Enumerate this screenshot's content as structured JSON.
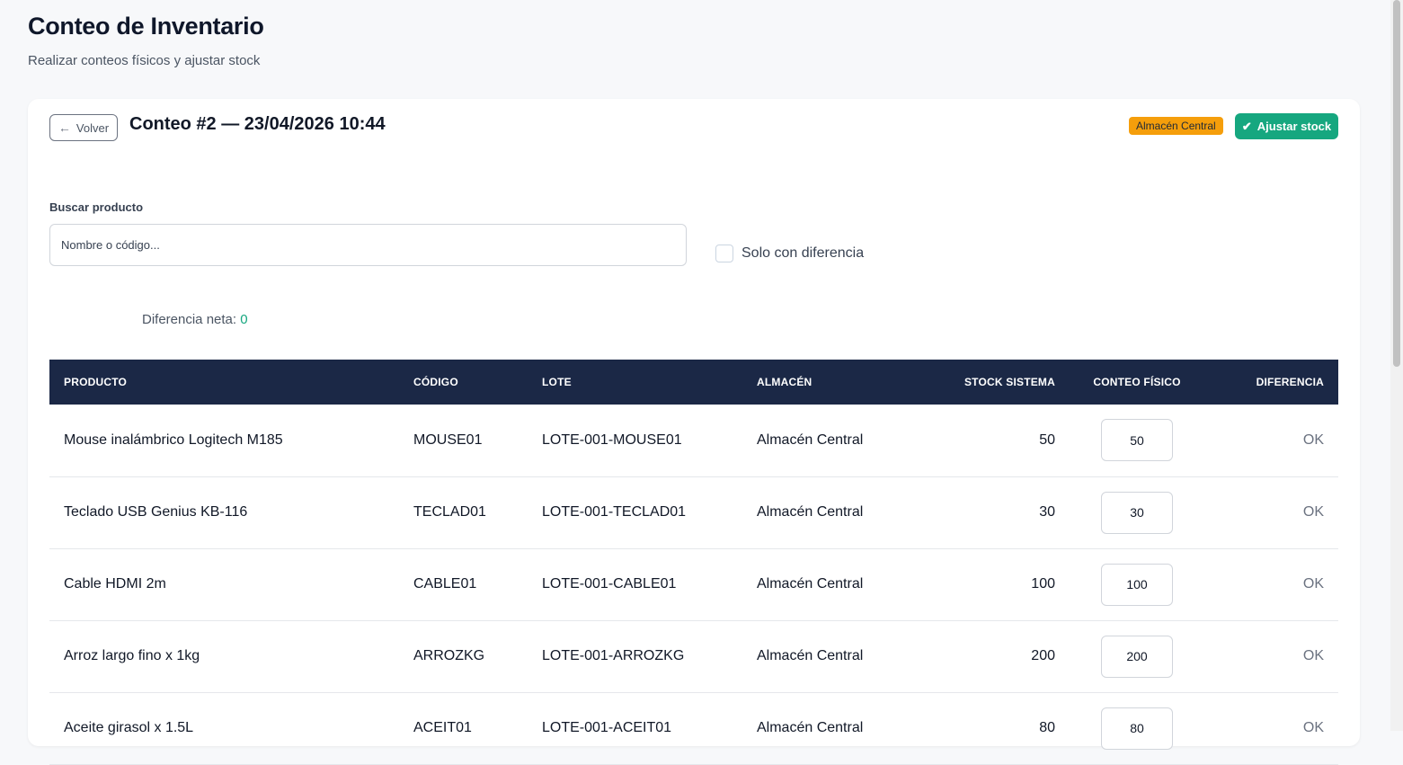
{
  "header": {
    "title": "Conteo de Inventario",
    "subtitle": "Realizar conteos físicos y ajustar stock"
  },
  "count": {
    "back_label": "Volver",
    "title": "Conteo #2 — 23/04/2026 10:44",
    "warehouse_badge": "Almacén Central",
    "adjust_label": "Ajustar stock"
  },
  "filters": {
    "search_label": "Buscar producto",
    "search_placeholder": "Nombre o código...",
    "search_value": "",
    "only_diff_label": "Solo con diferencia",
    "only_diff_checked": false
  },
  "summary": {
    "net_diff_label": "Diferencia neta:",
    "net_diff_value": "0"
  },
  "table": {
    "columns": [
      "PRODUCTO",
      "CÓDIGO",
      "LOTE",
      "ALMACÉN",
      "STOCK SISTEMA",
      "CONTEO FÍSICO",
      "DIFERENCIA"
    ],
    "rows": [
      {
        "product": "Mouse inalámbrico Logitech M185",
        "code": "MOUSE01",
        "lot": "LOTE-001-MOUSE01",
        "warehouse": "Almacén Central",
        "system_stock": "50",
        "physical_count": "50",
        "difference": "OK"
      },
      {
        "product": "Teclado USB Genius KB-116",
        "code": "TECLAD01",
        "lot": "LOTE-001-TECLAD01",
        "warehouse": "Almacén Central",
        "system_stock": "30",
        "physical_count": "30",
        "difference": "OK"
      },
      {
        "product": "Cable HDMI 2m",
        "code": "CABLE01",
        "lot": "LOTE-001-CABLE01",
        "warehouse": "Almacén Central",
        "system_stock": "100",
        "physical_count": "100",
        "difference": "OK"
      },
      {
        "product": "Arroz largo fino x 1kg",
        "code": "ARROZKG",
        "lot": "LOTE-001-ARROZKG",
        "warehouse": "Almacén Central",
        "system_stock": "200",
        "physical_count": "200",
        "difference": "OK"
      },
      {
        "product": "Aceite girasol x 1.5L",
        "code": "ACEIT01",
        "lot": "LOTE-001-ACEIT01",
        "warehouse": "Almacén Central",
        "system_stock": "80",
        "physical_count": "80",
        "difference": "OK"
      }
    ]
  },
  "colors": {
    "table_header_bg": "#1b2846",
    "accent_green": "#16a77f",
    "badge_amber": "#f59e0b"
  },
  "icons": {
    "back": "arrow-left-icon",
    "adjust": "check-icon"
  }
}
